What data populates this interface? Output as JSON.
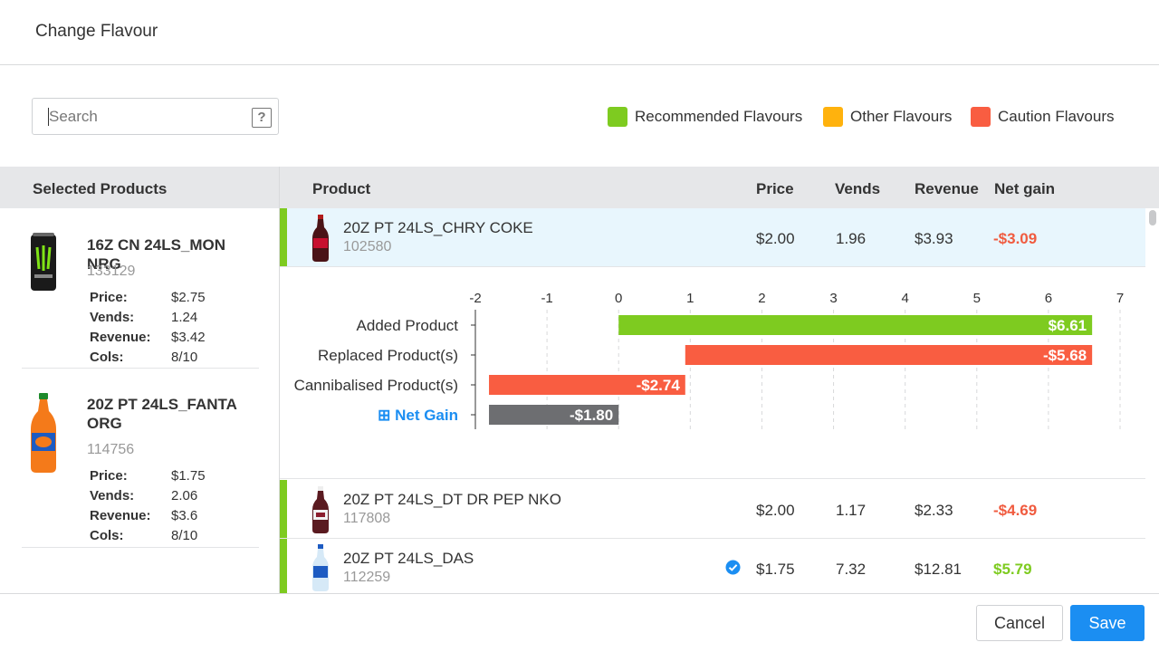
{
  "dialog": {
    "title": "Change Flavour"
  },
  "search": {
    "placeholder": "Search",
    "help": "?"
  },
  "legend": [
    {
      "label": "Recommended Flavours",
      "color": "#7ecb20"
    },
    {
      "label": "Other Flavours",
      "color": "#ffb20d"
    },
    {
      "label": "Caution Flavours",
      "color": "#f95d41"
    }
  ],
  "selected_products": {
    "header": "Selected Products",
    "labels": {
      "price": "Price:",
      "vends": "Vends:",
      "revenue": "Revenue:",
      "cols": "Cols:"
    },
    "items": [
      {
        "name": "16Z CN 24LS_MON NRG",
        "code": "133129",
        "price": "$2.75",
        "vends": "1.24",
        "revenue": "$3.42",
        "cols": "8/10",
        "icon": "monster-can-icon"
      },
      {
        "name": "20Z PT 24LS_FANTA ORG",
        "code": "114756",
        "price": "$1.75",
        "vends": "2.06",
        "revenue": "$3.6",
        "cols": "8/10",
        "icon": "fanta-bottle-icon"
      }
    ]
  },
  "table": {
    "headers": {
      "product": "Product",
      "price": "Price",
      "vends": "Vends",
      "revenue": "Revenue",
      "net_gain": "Net gain"
    },
    "rows": [
      {
        "name": "20Z PT 24LS_CHRY COKE",
        "code": "102580",
        "price": "$2.00",
        "vends": "1.96",
        "revenue": "$3.93",
        "net_gain": "-$3.09",
        "selected": true
      },
      {
        "name": "20Z PT 24LS_DT DR PEP NKO",
        "code": "117808",
        "price": "$2.00",
        "vends": "1.17",
        "revenue": "$2.33",
        "net_gain": "-$4.69"
      },
      {
        "name": "20Z PT 24LS_DAS",
        "code": "112259",
        "price": "$1.75",
        "vends": "7.32",
        "revenue": "$12.81",
        "net_gain": "$5.79",
        "recommended_check": true
      }
    ]
  },
  "chart_data": {
    "type": "bar",
    "orientation": "horizontal-waterfall",
    "xlim": [
      -2,
      7
    ],
    "x_ticks": [
      "-2",
      "-1",
      "0",
      "1",
      "2",
      "3",
      "4",
      "5",
      "6",
      "7"
    ],
    "categories": [
      "Added Product",
      "Replaced Product(s)",
      "Cannibalised Product(s)",
      "Net Gain"
    ],
    "net_gain_prefix": "⊞",
    "bars": [
      {
        "category": "Added Product",
        "start": 0,
        "end": 6.61,
        "value": 6.61,
        "label": "$6.61",
        "color": "#7ecb20"
      },
      {
        "category": "Replaced Product(s)",
        "start": 0.93,
        "end": 6.61,
        "value": -5.68,
        "label": "-$5.68",
        "color": "#f95d41"
      },
      {
        "category": "Cannibalised Product(s)",
        "start": -1.81,
        "end": 0.93,
        "value": -2.74,
        "label": "-$2.74",
        "color": "#f95d41"
      },
      {
        "category": "Net Gain",
        "start": -1.81,
        "end": 0,
        "value": -1.8,
        "label": "-$1.80",
        "color": "#6d6e71"
      }
    ],
    "grid": true
  },
  "footer": {
    "cancel": "Cancel",
    "save": "Save"
  }
}
